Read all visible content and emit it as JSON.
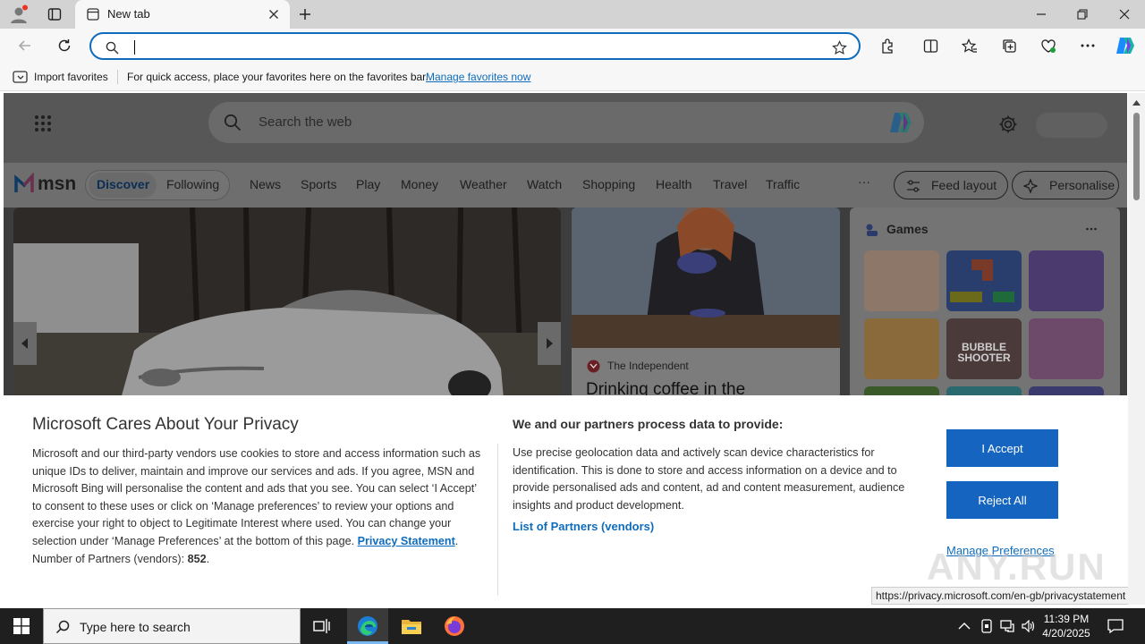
{
  "browser": {
    "tab_title": "New tab",
    "address_value": "",
    "favorites_bar": {
      "import_label": "Import favorites",
      "hint": "For quick access, place your favorites here on the favorites bar.",
      "manage_link": "Manage favorites now"
    }
  },
  "page": {
    "search_placeholder": "Search the web",
    "brand": "msn",
    "nav": [
      "Discover",
      "Following",
      "News",
      "Sports",
      "Play",
      "Money",
      "Weather",
      "Watch",
      "Shopping",
      "Health",
      "Travel",
      "Traffic"
    ],
    "more_label": "···",
    "feed_layout_label": "Feed layout",
    "personalise_label": "Personalise",
    "news_source": "The Independent",
    "news_headline": "Drinking coffee in the",
    "games_title": "Games",
    "bubble_tile_text": "BUBBLE SHOOTER"
  },
  "consent": {
    "title": "Microsoft Cares About Your Privacy",
    "body": "Microsoft and our third-party vendors use cookies to store and access information such as unique IDs to deliver, maintain and improve our services and ads. If you agree, MSN and Microsoft Bing will personalise the content and ads that you see. You can select ‘I Accept’ to consent to these uses or click on ‘Manage preferences’ to review your options and exercise your right to object to Legitimate Interest where used.  You can change your selection under ‘Manage Preferences’ at the bottom of this page.",
    "privacy_link": "Privacy Statement",
    "partners_label": "Number of Partners (vendors):",
    "partners_count": "852",
    "right_title": "We and our partners process data to provide:",
    "right_body": "Use precise geolocation data and actively scan device characteristics for identification. This is done to store and access information on a device and to provide personalised ads and content, ad and content measurement, audience insights and product development.",
    "partners_link": "List of Partners (vendors)",
    "accept": "I Accept",
    "reject": "Reject All",
    "manage": "Manage Preferences"
  },
  "status_url": "https://privacy.microsoft.com/en-gb/privacystatement",
  "taskbar": {
    "search_placeholder": "Type here to search",
    "time": "11:39 PM",
    "date": "4/20/2025"
  },
  "watermark": "ANY.RUN",
  "colors": {
    "accent": "#0f6cbd",
    "button": "#1565c0",
    "overlay": "#3d3d3d"
  }
}
